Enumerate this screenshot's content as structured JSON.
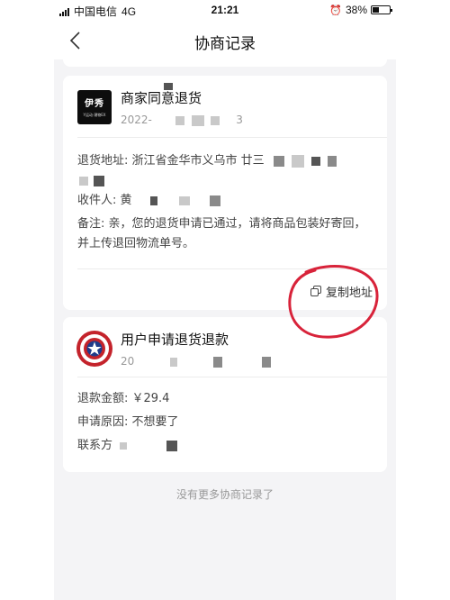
{
  "status_bar": {
    "carrier": "中国电信",
    "network": "4G",
    "time": "21:21",
    "battery": "38%",
    "battery_level": 0.38
  },
  "nav": {
    "title": "协商记录"
  },
  "records": [
    {
      "avatar_brand": "伊秀",
      "avatar_sub": "Y运动·潮物EX",
      "title": "商家同意退货",
      "date": "2022-",
      "date_suffix": "3",
      "address_label": "退货地址: 浙江省金华市义乌市 廿三",
      "recipient_label": "收件人: 黄",
      "note": "备注: 亲，您的退货申请已通过，请将商品包装好寄回，并上传退回物流单号。",
      "copy_button": "复制地址"
    },
    {
      "title": "用户申请退货退款",
      "date": "20",
      "refund_amount": "退款金额: ￥29.4",
      "reason": "申请原因: 不想要了",
      "contact": "联系方"
    }
  ],
  "footer": "没有更多协商记录了",
  "colors": {
    "background": "#f4f4f6",
    "card": "#ffffff",
    "annotation": "#d8233a",
    "shield_red": "#c4232b",
    "shield_blue": "#1f3b8a"
  }
}
